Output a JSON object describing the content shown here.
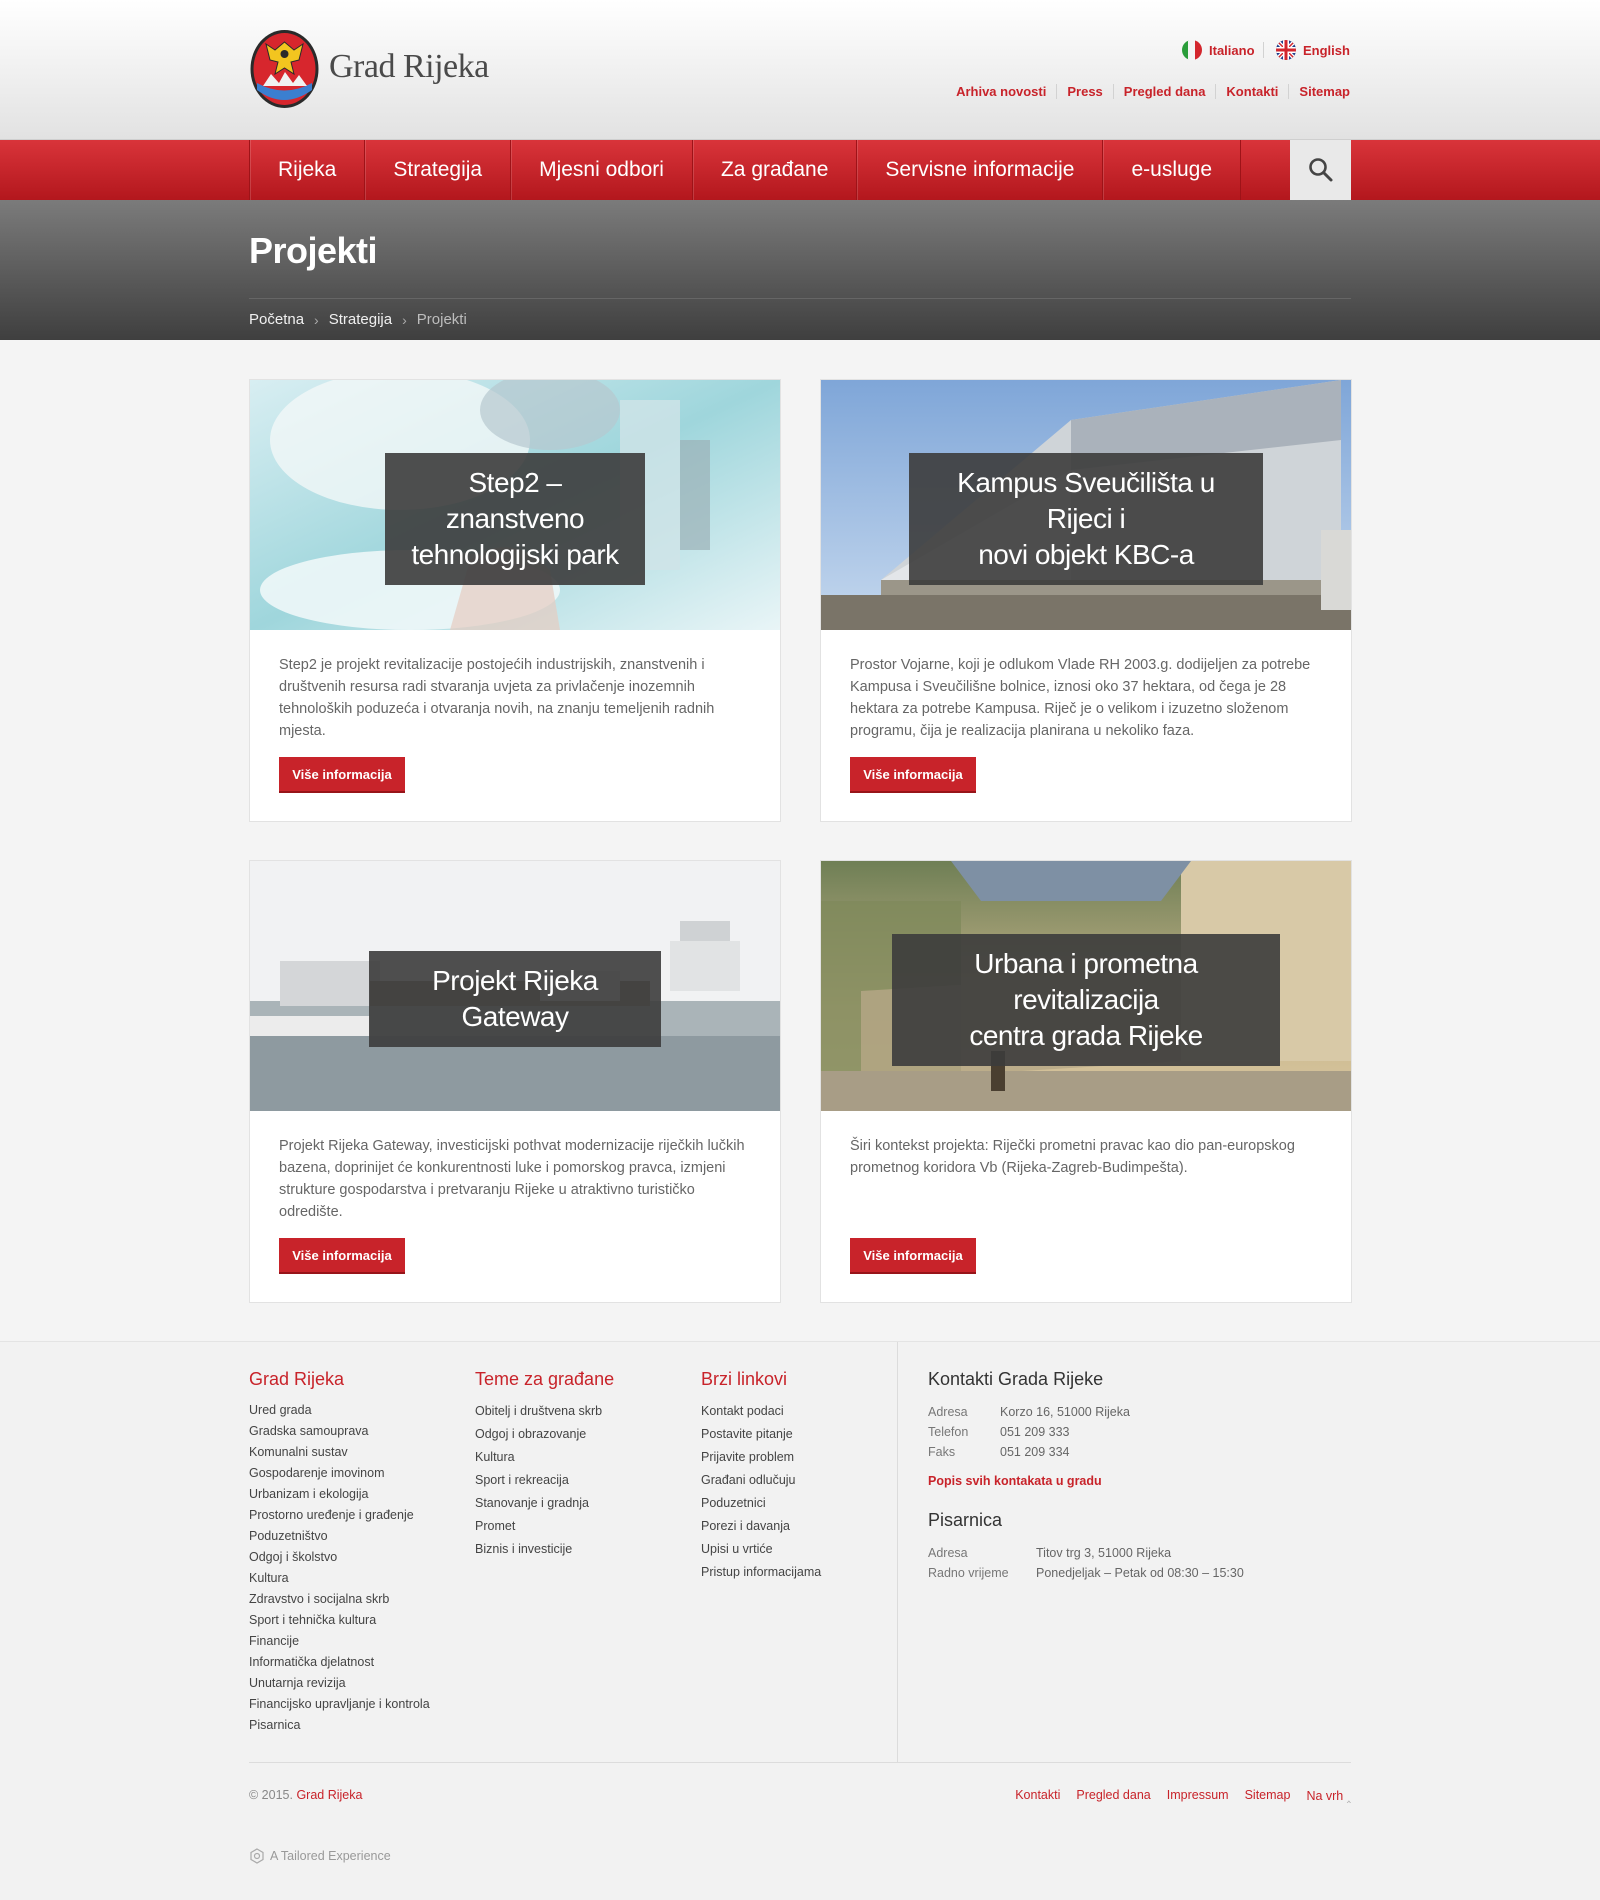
{
  "header": {
    "site_title": "Grad Rijeka",
    "languages": [
      {
        "label": "Italiano",
        "icon": "italy-flag-icon"
      },
      {
        "label": "English",
        "icon": "uk-flag-icon"
      }
    ],
    "top_links": [
      "Arhiva novosti",
      "Press",
      "Pregled dana",
      "Kontakti",
      "Sitemap"
    ]
  },
  "nav": {
    "items": [
      "Rijeka",
      "Strategija",
      "Mjesni odbori",
      "Za građane",
      "Servisne informacije",
      "e-usluge"
    ],
    "search_icon": "search-icon"
  },
  "page": {
    "title": "Projekti",
    "breadcrumb": [
      "Početna",
      "Strategija",
      "Projekti"
    ]
  },
  "cards": [
    {
      "title": "Step2 – znanstveno tehnologijski park",
      "title_lines": [
        "Step2 – znanstveno",
        "tehnologijski park"
      ],
      "text": "Step2 je projekt revitalizacije postojećih industrijskih, znanstvenih i društvenih resursa radi stvaranja uvjeta za privlačenje inozemnih tehnoloških poduzeća i otvaranja novih, na znanju temeljenih radnih mjesta.",
      "button": "Više informacija"
    },
    {
      "title": "Kampus Sveučilišta u Rijeci i novi objekt KBC-a",
      "title_lines": [
        "Kampus Sveučilišta u Rijeci i",
        "novi objekt KBC-a"
      ],
      "text": "Prostor Vojarne, koji je odlukom Vlade RH 2003.g. dodijeljen za potrebe Kampusa i Sveučilišne bolnice, iznosi oko 37 hektara, od čega je 28 hektara za potrebe Kampusa. Riječ je o velikom i izuzetno složenom programu,  čija je realizacija planirana u nekoliko faza.",
      "button": "Više informacija"
    },
    {
      "title": "Projekt Rijeka Gateway",
      "title_lines": [
        "Projekt Rijeka Gateway"
      ],
      "text": "Projekt Rijeka Gateway, investicijski pothvat modernizacije riječkih lučkih bazena, doprinijet će  konkurentnosti luke i pomorskog pravca, izmjeni strukture gospodarstva i pretvaranju Rijeke u atraktivno turističko odredište.",
      "button": "Više informacija"
    },
    {
      "title": "Urbana i prometna revitalizacija centra grada Rijeke",
      "title_lines": [
        "Urbana i prometna revitalizacija",
        "centra grada Rijeke"
      ],
      "text": "Širi kontekst projekta: Riječki prometni pravac kao dio pan-europskog prometnog koridora Vb (Rijeka-Zagreb-Budimpešta).",
      "button": "Više informacija"
    }
  ],
  "footer": {
    "col1": {
      "heading": "Grad Rijeka",
      "links": [
        "Ured grada",
        "Gradska samouprava",
        "Komunalni sustav",
        "Gospodarenje imovinom",
        "Urbanizam i ekologija",
        "Prostorno uređenje i građenje",
        "Poduzetništvo",
        "Odgoj i školstvo",
        "Kultura",
        "Zdravstvo i socijalna skrb",
        "Sport i tehnička kultura",
        "Financije",
        "Informatička djelatnost",
        "Unutarnja revizija",
        "Financijsko upravljanje i kontrola",
        "Pisarnica"
      ]
    },
    "col2": {
      "heading": "Teme za građane",
      "links": [
        "Obitelj i društvena skrb",
        "Odgoj i obrazovanje",
        "Kultura",
        "Sport i rekreacija",
        "Stanovanje i gradnja",
        "Promet",
        "Biznis i investicije"
      ]
    },
    "col3": {
      "heading": "Brzi linkovi",
      "links": [
        "Kontakt podaci",
        "Postavite pitanje",
        "Prijavite problem",
        "Građani odlučuju",
        "Poduzetnici",
        "Porezi i davanja",
        "Upisi u vrtiće",
        "Pristup informacijama"
      ]
    },
    "contacts": {
      "heading": "Kontakti Grada Rijeke",
      "rows": [
        {
          "key": "Adresa",
          "value": "Korzo 16, 51000 Rijeka"
        },
        {
          "key": "Telefon",
          "value": "051 209 333"
        },
        {
          "key": "Faks",
          "value": "051 209 334"
        }
      ],
      "link": "Popis svih kontakata u gradu"
    },
    "pisarnica": {
      "heading": "Pisarnica",
      "rows": [
        {
          "key": "Adresa",
          "value": "Titov trg 3, 51000 Rijeka"
        },
        {
          "key": "Radno vrijeme",
          "value": "Ponedjeljak – Petak od 08:30 – 15:30"
        }
      ]
    },
    "copyright_prefix": "© 2015.",
    "copyright_name": "Grad Rijeka",
    "bottom_links": [
      "Kontakti",
      "Pregled dana",
      "Impressum",
      "Sitemap",
      "Na vrh"
    ],
    "tailored": "A Tailored Experience"
  },
  "colors": {
    "brand_red": "#c8232a",
    "nav_red": "#d9343a",
    "dark_header": "#4a4a4a"
  }
}
